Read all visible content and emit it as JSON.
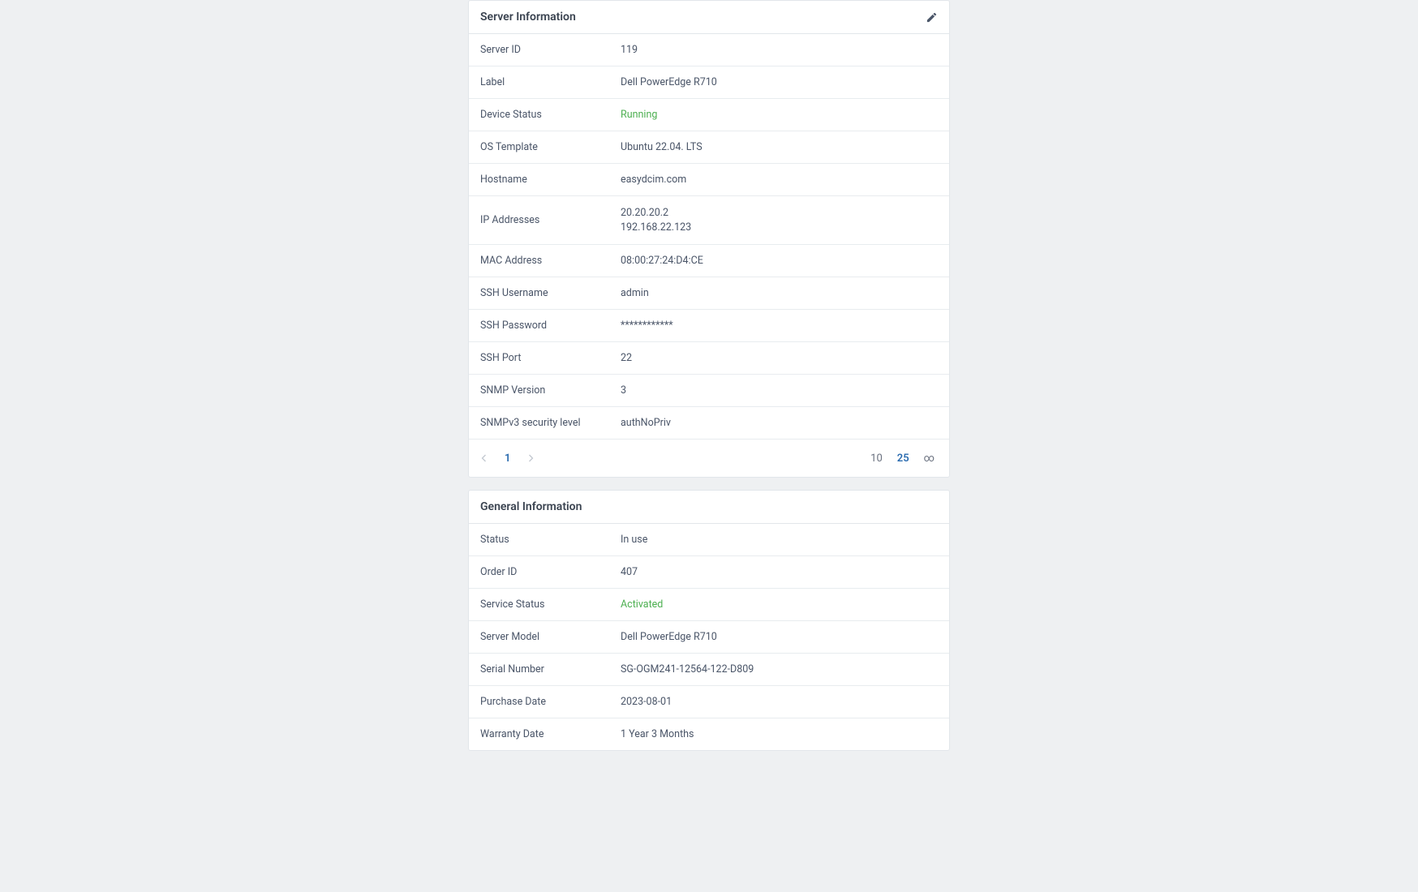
{
  "serverInfo": {
    "title": "Server Information",
    "rows": {
      "serverId": {
        "label": "Server ID",
        "value": "119"
      },
      "label": {
        "label": "Label",
        "value": "Dell PowerEdge R710"
      },
      "deviceStatus": {
        "label": "Device Status",
        "value": "Running"
      },
      "osTemplate": {
        "label": "OS Template",
        "value": "Ubuntu 22.04. LTS"
      },
      "hostname": {
        "label": "Hostname",
        "value": "easydcim.com"
      },
      "ipAddresses": {
        "label": "IP Addresses",
        "value1": "20.20.20.2",
        "value2": "192.168.22.123"
      },
      "macAddress": {
        "label": "MAC Address",
        "value": "08:00:27:24:D4:CE"
      },
      "sshUsername": {
        "label": "SSH Username",
        "value": "admin"
      },
      "sshPassword": {
        "label": "SSH Password",
        "value": "************"
      },
      "sshPort": {
        "label": "SSH Port",
        "value": "22"
      },
      "snmpVersion": {
        "label": "SNMP Version",
        "value": "3"
      },
      "snmpv3Security": {
        "label": "SNMPv3 security level",
        "value": "authNoPriv"
      }
    }
  },
  "pagination": {
    "currentPage": "1",
    "size10": "10",
    "size25": "25",
    "sizeAll": "∞"
  },
  "generalInfo": {
    "title": "General Information",
    "rows": {
      "status": {
        "label": "Status",
        "value": "In use"
      },
      "orderId": {
        "label": "Order ID",
        "value": "407"
      },
      "serviceStatus": {
        "label": "Service Status",
        "value": "Activated"
      },
      "serverModel": {
        "label": "Server Model",
        "value": "Dell PowerEdge R710"
      },
      "serialNumber": {
        "label": "Serial Number",
        "value": "SG-OGM241-12564-122-D809"
      },
      "purchaseDate": {
        "label": "Purchase Date",
        "value": "2023-08-01"
      },
      "warrantyDate": {
        "label": "Warranty Date",
        "value": "1 Year 3 Months"
      }
    }
  }
}
